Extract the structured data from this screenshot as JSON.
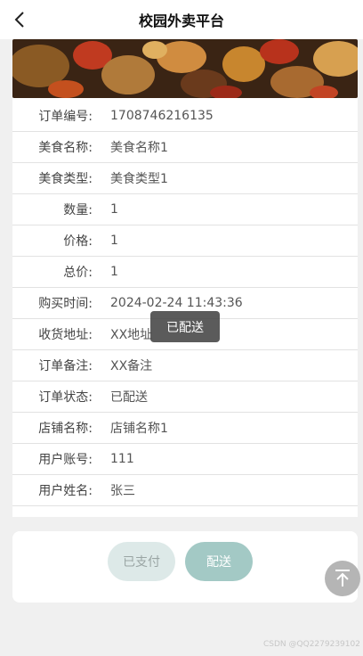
{
  "header": {
    "title": "校园外卖平台",
    "back_icon": "chevron-left-icon"
  },
  "banner": {
    "image": "food-photo-spicy-chicken"
  },
  "details": [
    {
      "label": "订单编号:",
      "value": "1708746216135"
    },
    {
      "label": "美食名称:",
      "value": "美食名称1"
    },
    {
      "label": "美食类型:",
      "value": "美食类型1"
    },
    {
      "label": "数量:",
      "value": "1"
    },
    {
      "label": "价格:",
      "value": "1"
    },
    {
      "label": "总价:",
      "value": "1"
    },
    {
      "label": "购买时间:",
      "value": "2024-02-24 11:43:36"
    },
    {
      "label": "收货地址:",
      "value": "XX地址"
    },
    {
      "label": "订单备注:",
      "value": "XX备注"
    },
    {
      "label": "订单状态:",
      "value": "已配送"
    },
    {
      "label": "店铺名称:",
      "value": "店铺名称1"
    },
    {
      "label": "用户账号:",
      "value": "111"
    },
    {
      "label": "用户姓名:",
      "value": "张三"
    }
  ],
  "toast": {
    "text": "已配送"
  },
  "actions": {
    "paid_label": "已支付",
    "deliver_label": "配送"
  },
  "scroll_top_icon": "arrow-up-to-top-icon",
  "watermark": "CSDN @QQ2279239102",
  "colors": {
    "deliver_button": "#a3c9c5",
    "paid_button": "#dde9e8",
    "background": "#f0f0f0"
  }
}
